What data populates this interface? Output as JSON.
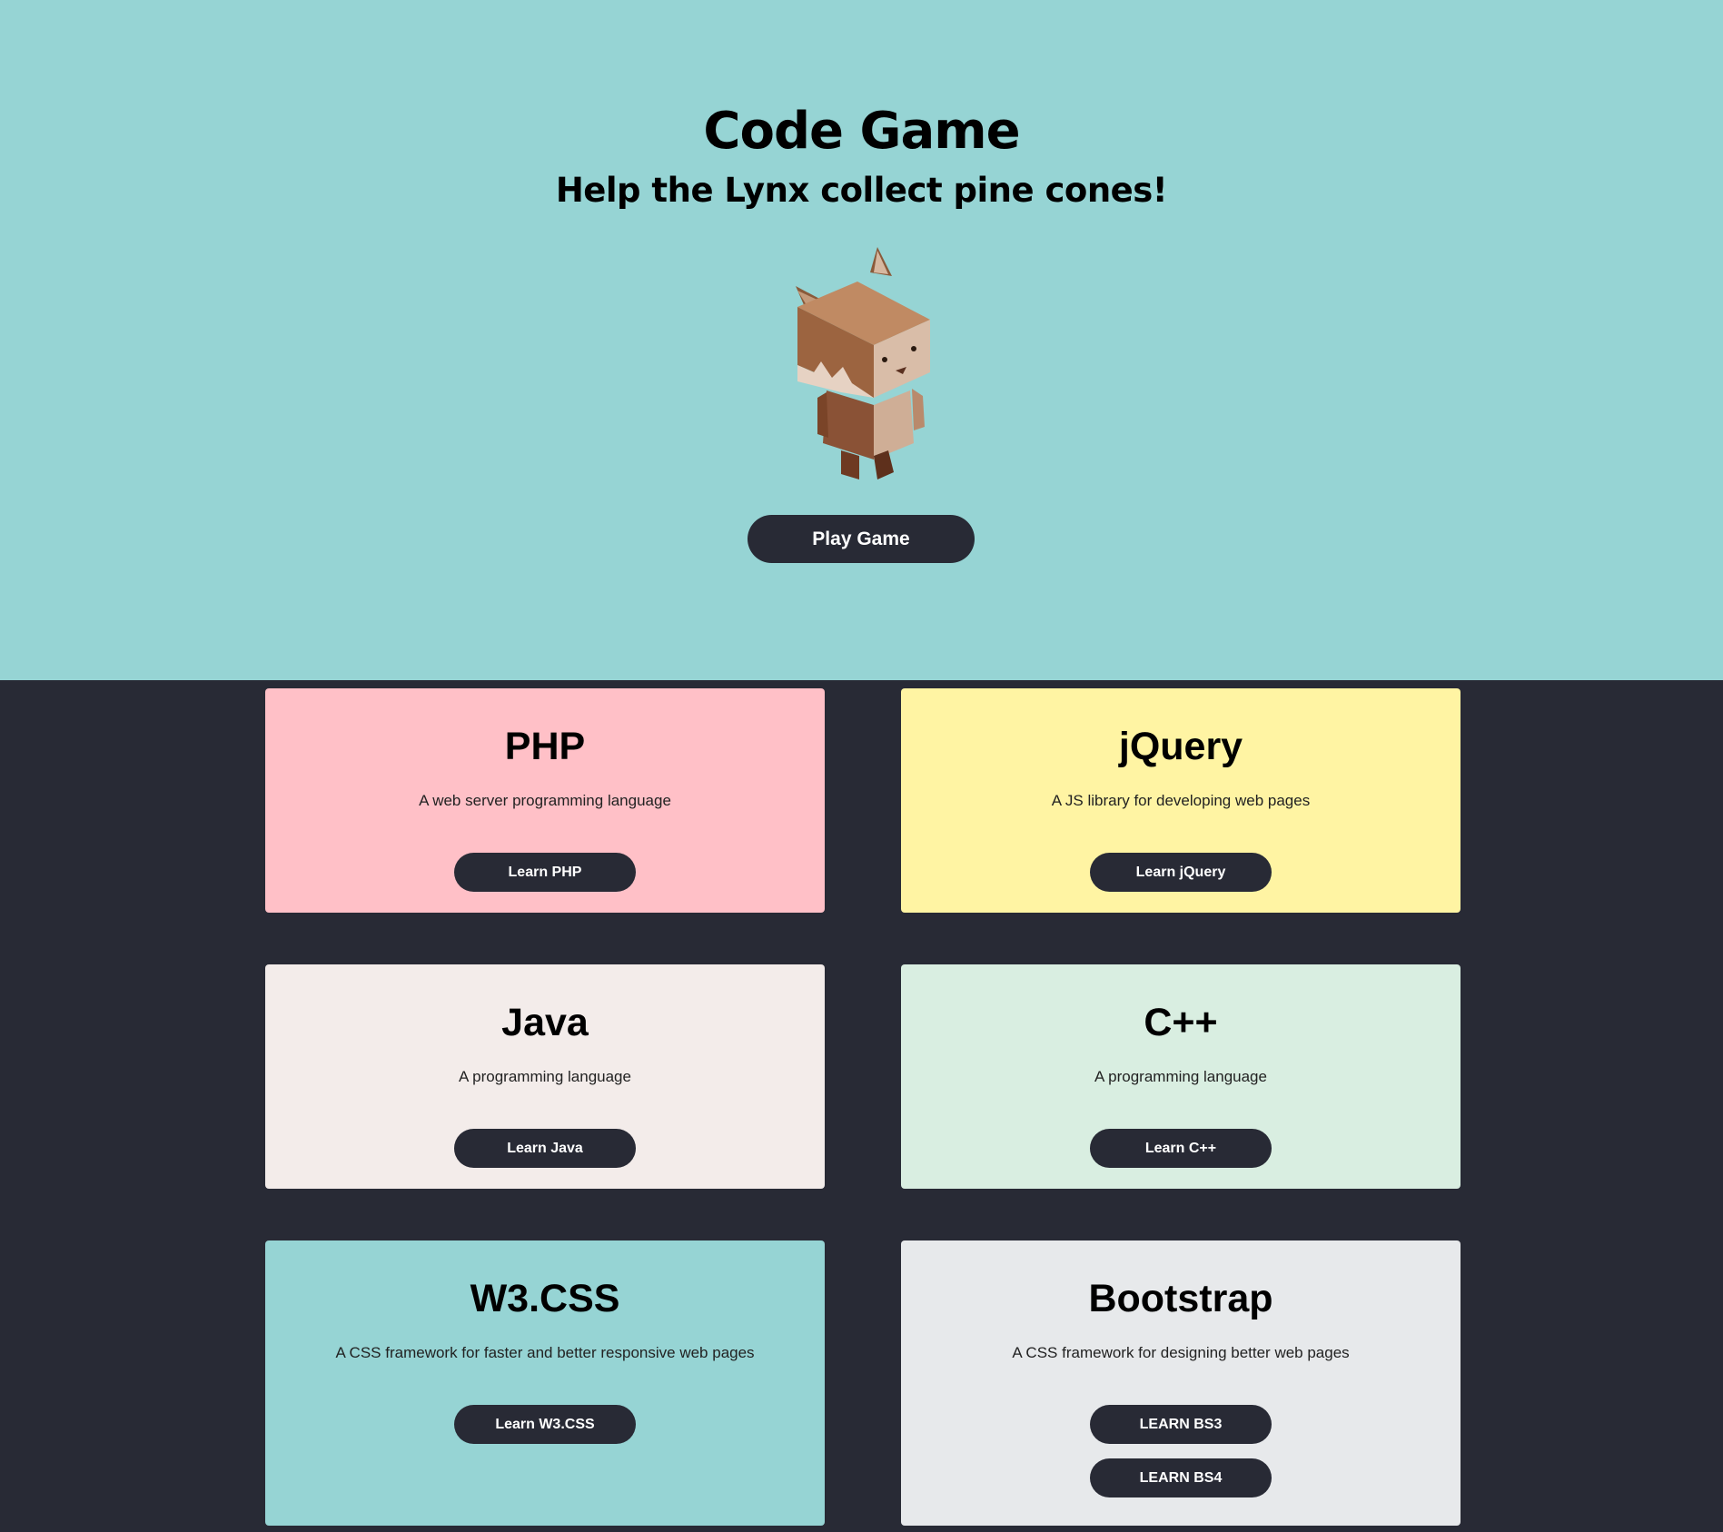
{
  "hero": {
    "title": "Code Game",
    "subtitle": "Help the Lynx collect pine cones!",
    "play_label": "Play Game",
    "background": "#96d4d4",
    "image": "lynx-mascot"
  },
  "cards": [
    {
      "title": "PHP",
      "description": "A web server programming language",
      "buttons": [
        "Learn PHP"
      ],
      "color": "#ffc0c7"
    },
    {
      "title": "jQuery",
      "description": "A JS library for developing web pages",
      "buttons": [
        "Learn jQuery"
      ],
      "color": "#fff4a3"
    },
    {
      "title": "Java",
      "description": "A programming language",
      "buttons": [
        "Learn Java"
      ],
      "color": "#f3ecea"
    },
    {
      "title": "C++",
      "description": "A programming language",
      "buttons": [
        "Learn C++"
      ],
      "color": "#d9eee1"
    },
    {
      "title": "W3.CSS",
      "description": "A CSS framework for faster and better responsive web pages",
      "buttons": [
        "Learn W3.CSS"
      ],
      "color": "#96d4d4"
    },
    {
      "title": "Bootstrap",
      "description": "A CSS framework for designing better web pages",
      "buttons": [
        "LEARN BS3",
        "LEARN BS4"
      ],
      "color": "#e7e9eb"
    }
  ],
  "colors": {
    "page_background": "#282a35",
    "button_background": "#282a35",
    "button_text": "#ffffff"
  }
}
